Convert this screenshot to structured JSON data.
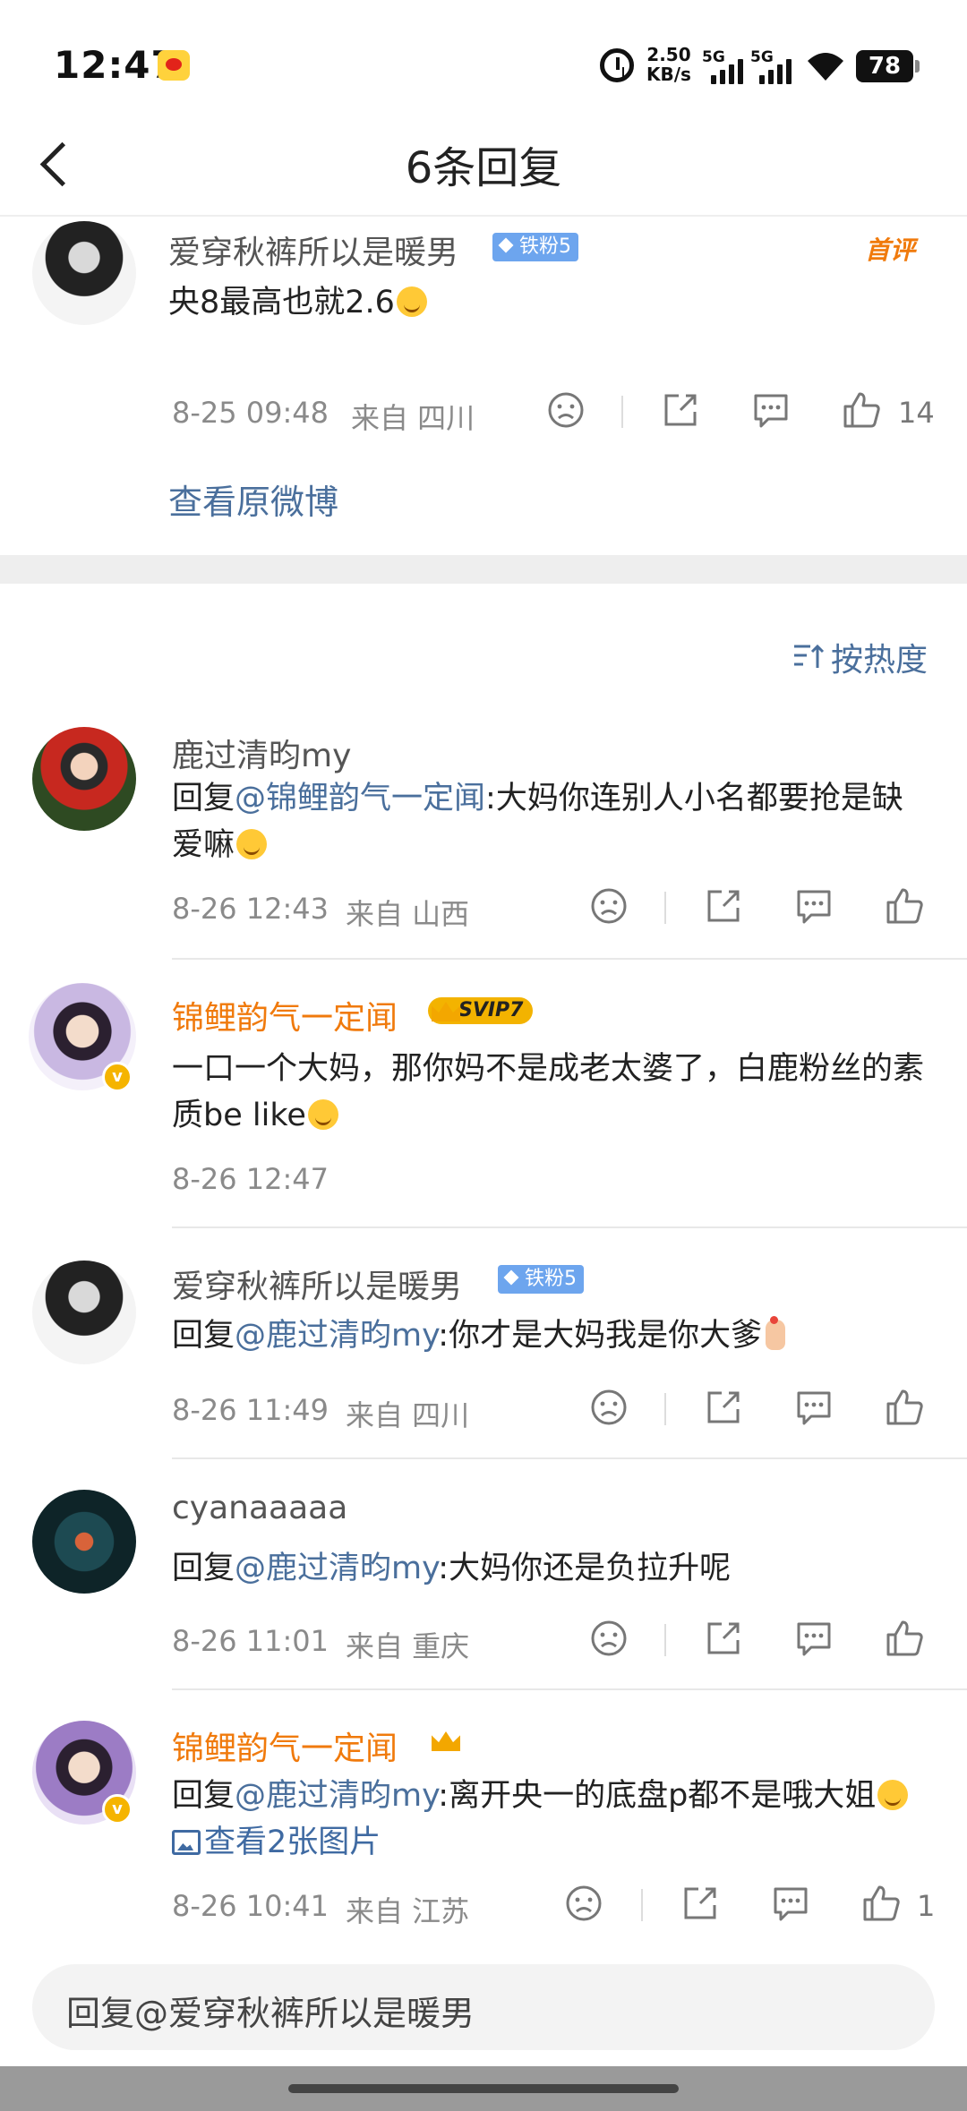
{
  "status_bar": {
    "time": "12:47",
    "net_speed_value": "2.50",
    "net_speed_unit": "KB/s",
    "signal_1": "5G",
    "signal_2": "5G",
    "battery": "78"
  },
  "nav": {
    "title": "6条回复"
  },
  "main_comment": {
    "username": "爱穿秋裤所以是暖男",
    "fan_badge": "铁粉5",
    "tag": "首评",
    "text": "央8最高也就2.6",
    "time": "8-25 09:48",
    "location": "来自 四川",
    "like_count": "14",
    "view_original": "查看原微博"
  },
  "sort": {
    "label": "按热度"
  },
  "replies": [
    {
      "username": "鹿过清昀my",
      "prefix": "回复",
      "mention": "@锦鲤韵气一定闻",
      "text": ":大妈你连别人小名都要抢是缺爱嘛",
      "time": "8-26 12:43",
      "location": "来自 山西"
    },
    {
      "username": "锦鲤韵气一定闻",
      "badge": "SVIP7",
      "text": "一口一个大妈，那你妈不是成老太婆了，白鹿粉丝的素质be like",
      "time": "8-26 12:47"
    },
    {
      "username": "爱穿秋裤所以是暖男",
      "fan_badge": "铁粉5",
      "prefix": "回复",
      "mention": "@鹿过清昀my",
      "text": ":你才是大妈我是你大爹",
      "time": "8-26 11:49",
      "location": "来自 四川"
    },
    {
      "username": "cyanaaaaa",
      "prefix": "回复",
      "mention": "@鹿过清昀my",
      "text": ":大妈你还是负拉升呢",
      "time": "8-26 11:01",
      "location": "来自 重庆"
    },
    {
      "username": "锦鲤韵气一定闻",
      "prefix": "回复",
      "mention": "@鹿过清昀my",
      "text": ":离开央一的底盘p都不是哦大姐",
      "link": "查看2张图片",
      "time": "8-26 10:41",
      "location": "来自 江苏",
      "like_count": "1"
    }
  ],
  "reply_input": {
    "placeholder": "回复@爱穿秋裤所以是暖男"
  },
  "colors": {
    "link_blue": "#4a6f9c",
    "vip_orange": "#f07a0c",
    "fan_badge_blue": "#6da5ee",
    "svip_gold": "#f3b300"
  }
}
